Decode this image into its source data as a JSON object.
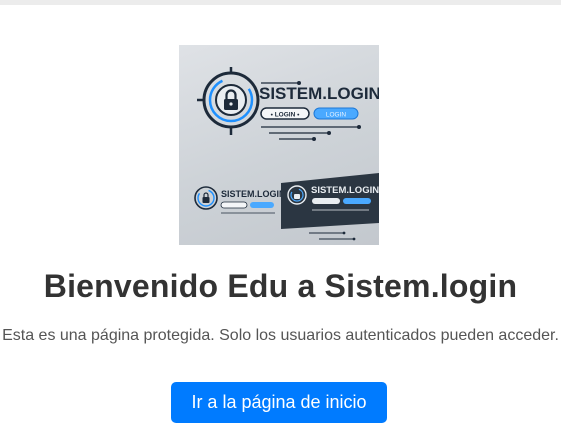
{
  "logo": {
    "brand_main": "SISTEM.LOGIN",
    "login_pill_1": "• LOGIN •",
    "login_pill_2": "LOGIN",
    "brand_small_1": "SISTEM.LOGIN",
    "brand_small_2": "SISTEM.LOGIN",
    "colors": {
      "dark": "#1d2a3a",
      "accent": "#1e90ff",
      "background": "#d6dadf"
    }
  },
  "page": {
    "title": "Bienvenido Edu a Sistem.login",
    "subtitle": "Esta es una página protegida. Solo los usuarios autenticados pueden acceder.",
    "home_button_label": "Ir a la página de inicio"
  },
  "theme": {
    "button_color": "#007bff",
    "title_color": "#333333",
    "text_color": "#555555"
  }
}
